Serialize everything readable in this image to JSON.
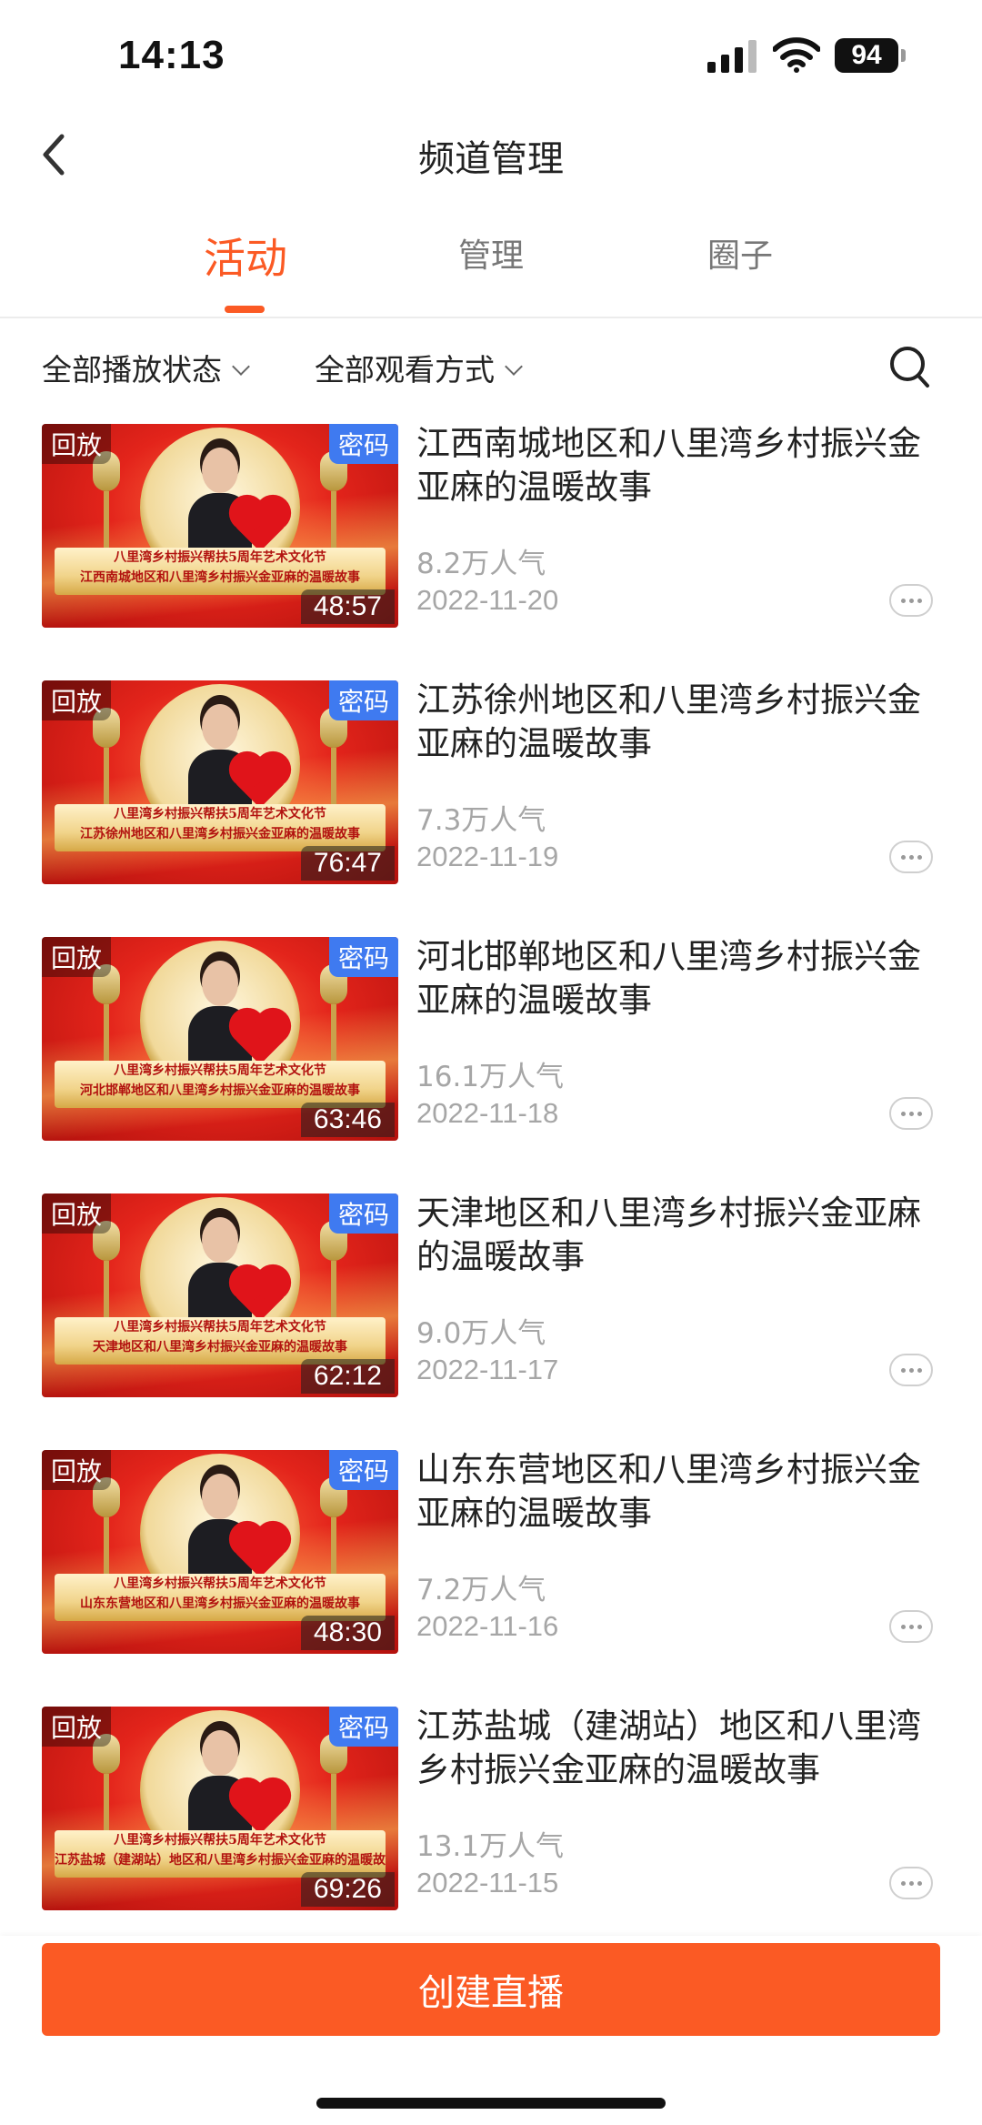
{
  "status_bar": {
    "time": "14:13",
    "battery": "94"
  },
  "nav": {
    "title": "频道管理"
  },
  "tabs": [
    {
      "label": "活动",
      "active": true
    },
    {
      "label": "管理",
      "active": false
    },
    {
      "label": "圈子",
      "active": false
    }
  ],
  "filters": {
    "status": "全部播放状态",
    "view_mode": "全部观看方式"
  },
  "items": [
    {
      "title": "江西南城地区和八里湾乡村振兴金亚麻的温暖故事",
      "popularity": "8.2万人气",
      "date": "2022-11-20",
      "duration": "48:57",
      "replay_tag": "回放",
      "pwd_tag": "密码",
      "banner_line1": "八里湾乡村振兴帮扶5周年艺术文化节",
      "banner_line2": "江西南城地区和八里湾乡村振兴金亚麻的温暖故事"
    },
    {
      "title": "江苏徐州地区和八里湾乡村振兴金亚麻的温暖故事",
      "popularity": "7.3万人气",
      "date": "2022-11-19",
      "duration": "76:47",
      "replay_tag": "回放",
      "pwd_tag": "密码",
      "banner_line1": "八里湾乡村振兴帮扶5周年艺术文化节",
      "banner_line2": "江苏徐州地区和八里湾乡村振兴金亚麻的温暖故事"
    },
    {
      "title": "河北邯郸地区和八里湾乡村振兴金亚麻的温暖故事",
      "popularity": "16.1万人气",
      "date": "2022-11-18",
      "duration": "63:46",
      "replay_tag": "回放",
      "pwd_tag": "密码",
      "banner_line1": "八里湾乡村振兴帮扶5周年艺术文化节",
      "banner_line2": "河北邯郸地区和八里湾乡村振兴金亚麻的温暖故事"
    },
    {
      "title": "天津地区和八里湾乡村振兴金亚麻的温暖故事",
      "popularity": "9.0万人气",
      "date": "2022-11-17",
      "duration": "62:12",
      "replay_tag": "回放",
      "pwd_tag": "密码",
      "banner_line1": "八里湾乡村振兴帮扶5周年艺术文化节",
      "banner_line2": "天津地区和八里湾乡村振兴金亚麻的温暖故事"
    },
    {
      "title": "山东东营地区和八里湾乡村振兴金亚麻的温暖故事",
      "popularity": "7.2万人气",
      "date": "2022-11-16",
      "duration": "48:30",
      "replay_tag": "回放",
      "pwd_tag": "密码",
      "banner_line1": "八里湾乡村振兴帮扶5周年艺术文化节",
      "banner_line2": "山东东营地区和八里湾乡村振兴金亚麻的温暖故事"
    },
    {
      "title": "江苏盐城（建湖站）地区和八里湾乡村振兴金亚麻的温暖故事",
      "popularity": "13.1万人气",
      "date": "2022-11-15",
      "duration": "69:26",
      "replay_tag": "回放",
      "pwd_tag": "密码",
      "banner_line1": "八里湾乡村振兴帮扶5周年艺术文化节",
      "banner_line2": "江苏盐城（建湖站）地区和八里湾乡村振兴金亚麻的温暖故事"
    }
  ],
  "footer": {
    "create_button": "创建直播"
  },
  "colors": {
    "accent": "#fb5a24",
    "password_tag": "#3f7af0",
    "muted_text": "#a6a6a6"
  },
  "icons": {
    "back": "chevron-left-icon",
    "search": "search-icon",
    "more": "more-dots-icon"
  }
}
